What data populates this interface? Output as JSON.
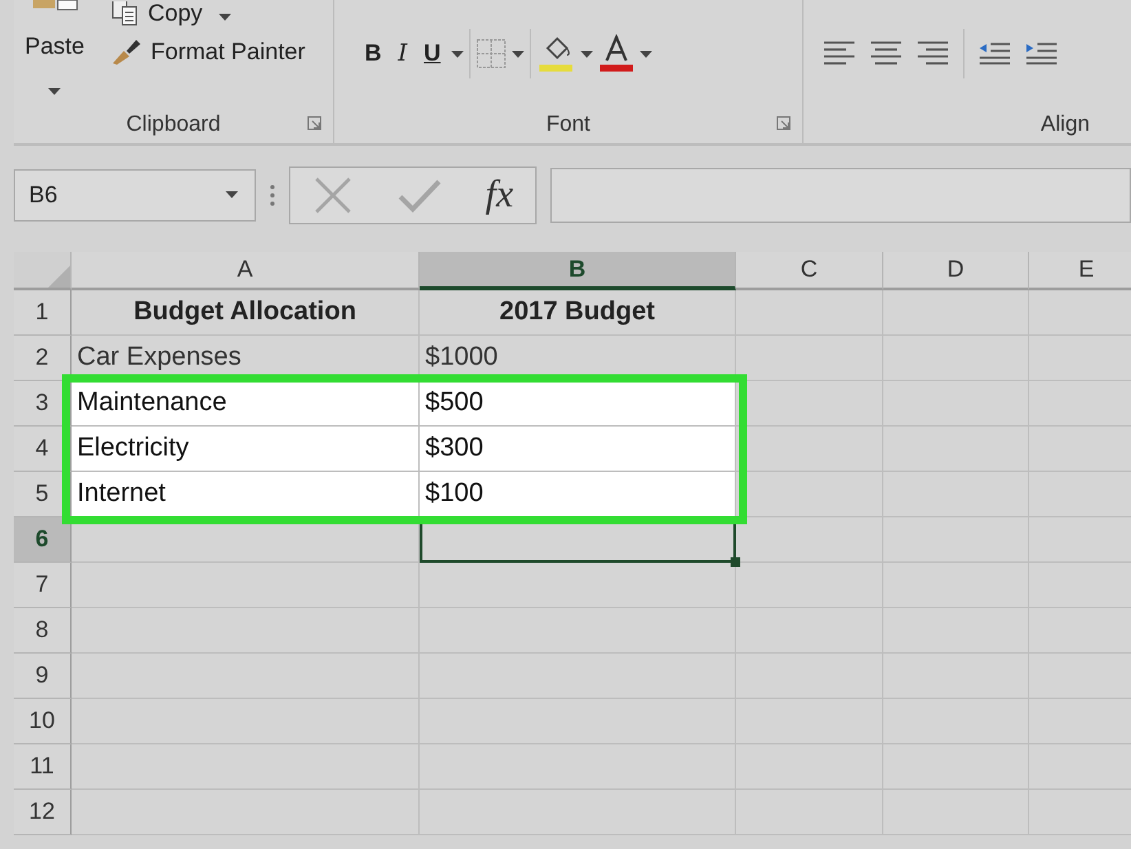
{
  "ribbon": {
    "clipboard": {
      "paste": "Paste",
      "copy": "Copy",
      "format_painter": "Format Painter",
      "label": "Clipboard"
    },
    "font": {
      "bold": "B",
      "italic": "I",
      "underline": "U",
      "label": "Font"
    },
    "alignment": {
      "label": "Align"
    }
  },
  "formula_bar": {
    "name_box": "B6",
    "function_label": "fx"
  },
  "columns": [
    {
      "label": "A",
      "selected": false
    },
    {
      "label": "B",
      "selected": true
    },
    {
      "label": "C",
      "selected": false
    },
    {
      "label": "D",
      "selected": false
    },
    {
      "label": "E",
      "selected": false
    }
  ],
  "rows": [
    {
      "header": "1",
      "kind": "heading",
      "cells": [
        "Budget Allocation",
        "2017 Budget"
      ],
      "highlighted": false,
      "selected": false
    },
    {
      "header": "2",
      "kind": "data",
      "cells": [
        "Car Expenses",
        "$1000"
      ],
      "highlighted": false,
      "selected": false
    },
    {
      "header": "3",
      "kind": "data",
      "cells": [
        "Maintenance",
        "$500"
      ],
      "highlighted": true,
      "selected": false
    },
    {
      "header": "4",
      "kind": "data",
      "cells": [
        "Electricity",
        "$300"
      ],
      "highlighted": true,
      "selected": false
    },
    {
      "header": "5",
      "kind": "data",
      "cells": [
        "Internet",
        "$100"
      ],
      "highlighted": true,
      "selected": false
    },
    {
      "header": "6",
      "kind": "data",
      "highlighted": false,
      "selected": true
    },
    {
      "header": "7",
      "kind": "data",
      "highlighted": false,
      "selected": false
    },
    {
      "header": "8",
      "kind": "data",
      "highlighted": false,
      "selected": false
    },
    {
      "header": "9",
      "kind": "data",
      "highlighted": false,
      "selected": false
    },
    {
      "header": "10",
      "kind": "data",
      "highlighted": false,
      "selected": false
    },
    {
      "header": "11",
      "kind": "data",
      "highlighted": false,
      "selected": false
    },
    {
      "header": "12",
      "kind": "data",
      "highlighted": false,
      "selected": false
    }
  ]
}
